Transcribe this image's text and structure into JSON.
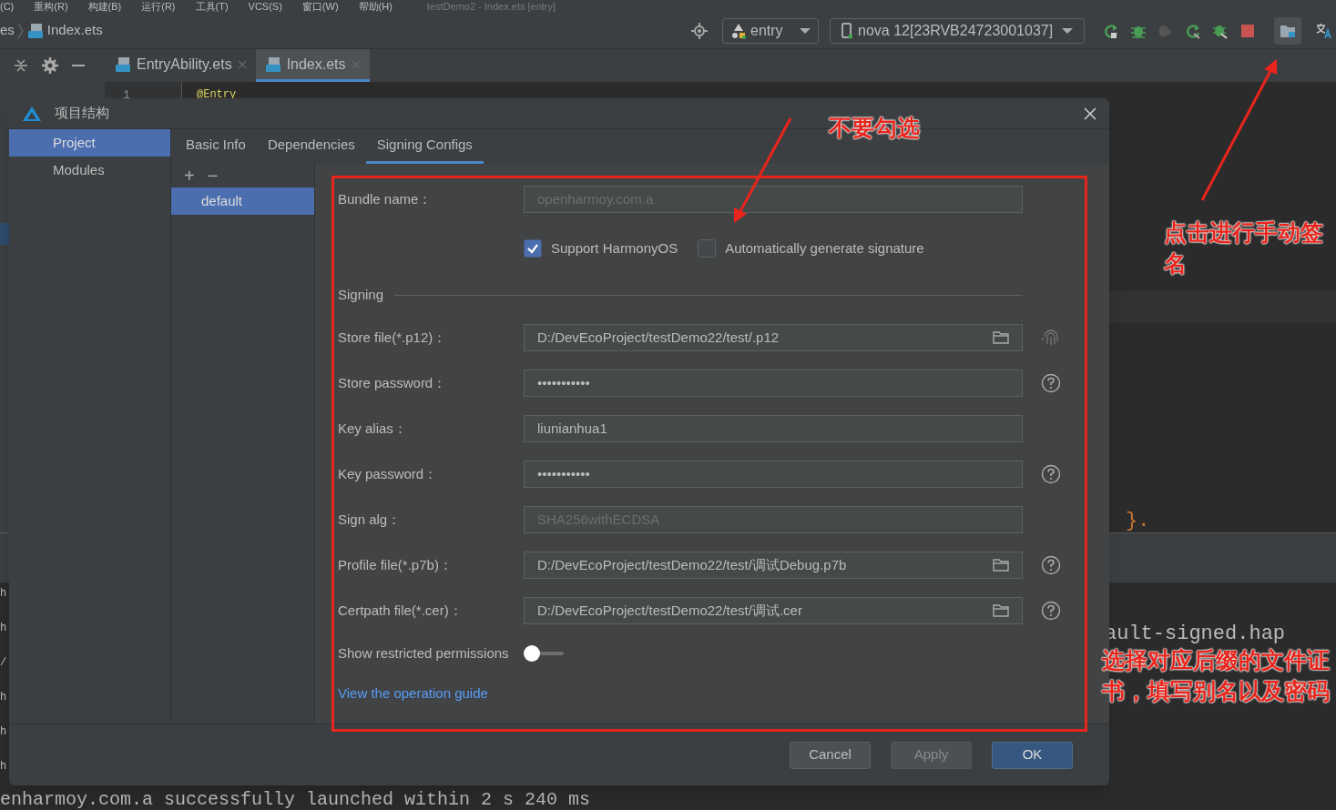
{
  "menu_bar": {
    "items": [
      "(C)",
      "重构(R)",
      "构建(B)",
      "运行(R)",
      "工具(T)",
      "VCS(S)",
      "窗口(W)",
      "帮助(H)"
    ],
    "title": "testDemo2 - Index.ets [entry]"
  },
  "breadcrumb": [
    "es",
    "Index.ets"
  ],
  "toolbar": {
    "run_config": "entry",
    "device": "nova 12[23RVB24723001037]"
  },
  "editor_tabs": [
    {
      "label": "EntryAbility.ets",
      "selected": false
    },
    {
      "label": "Index.ets",
      "selected": true
    }
  ],
  "editor": {
    "line_number": "1",
    "first_line": "@Entry",
    "fragment": "}.",
    "output_fragment": "ault-signed.hap"
  },
  "run_log": {
    "left_fragments": [
      "h",
      "h",
      "/",
      "h",
      "h",
      "h"
    ],
    "last_line": "enharmoy.com.a successfully launched within 2 s 240 ms"
  },
  "dialog": {
    "title": "项目结构",
    "nav": [
      {
        "label": "Project",
        "selected": true
      },
      {
        "label": "Modules",
        "selected": false
      }
    ],
    "tabs": [
      {
        "label": "Basic Info",
        "selected": false
      },
      {
        "label": "Dependencies",
        "selected": false
      },
      {
        "label": "Signing Configs",
        "selected": true
      }
    ],
    "add_label": "+",
    "remove_label": "−",
    "configs": [
      {
        "label": "default",
        "selected": true
      }
    ],
    "fields": [
      {
        "kind": "text",
        "label": "Bundle name：",
        "value": "openharmoy.com.a",
        "disabled": true
      },
      {
        "kind": "checks",
        "items": [
          {
            "label": "Support HarmonyOS",
            "checked": true
          },
          {
            "label": "Automatically generate signature",
            "checked": false
          }
        ]
      },
      {
        "kind": "section",
        "label": "Signing"
      },
      {
        "kind": "file",
        "label": "Store file(*.p12)：",
        "value": "D:/DevEcoProject/testDemo22/test/.p12",
        "fingerprint": true
      },
      {
        "kind": "password",
        "label": "Store password：",
        "value": "•••••••••••",
        "help": true
      },
      {
        "kind": "text",
        "label": "Key alias：",
        "value": "liunianhua1",
        "disabled": false
      },
      {
        "kind": "password",
        "label": "Key password：",
        "value": "•••••••••••",
        "help": true
      },
      {
        "kind": "text",
        "label": "Sign alg：",
        "value": "SHA256withECDSA",
        "disabled": true
      },
      {
        "kind": "file",
        "label": "Profile file(*.p7b)：",
        "value": "D:/DevEcoProject/testDemo22/test/调试Debug.p7b",
        "help": true
      },
      {
        "kind": "file",
        "label": "Certpath file(*.cer)：",
        "value": "D:/DevEcoProject/testDemo22/test/调试.cer",
        "help": true
      },
      {
        "kind": "toggle",
        "label": "Show restricted permissions",
        "on": false
      },
      {
        "kind": "link",
        "label": "View the operation guide"
      }
    ],
    "buttons": [
      {
        "label": "Cancel",
        "kind": "secondary"
      },
      {
        "label": "Apply",
        "kind": "disabled"
      },
      {
        "label": "OK",
        "kind": "primary"
      }
    ]
  },
  "annotations": [
    {
      "text": "不要勾选"
    },
    {
      "text": "点击进行手动签名"
    },
    {
      "text": "选择对应后缀的文件证书，填写别名以及密码"
    }
  ]
}
